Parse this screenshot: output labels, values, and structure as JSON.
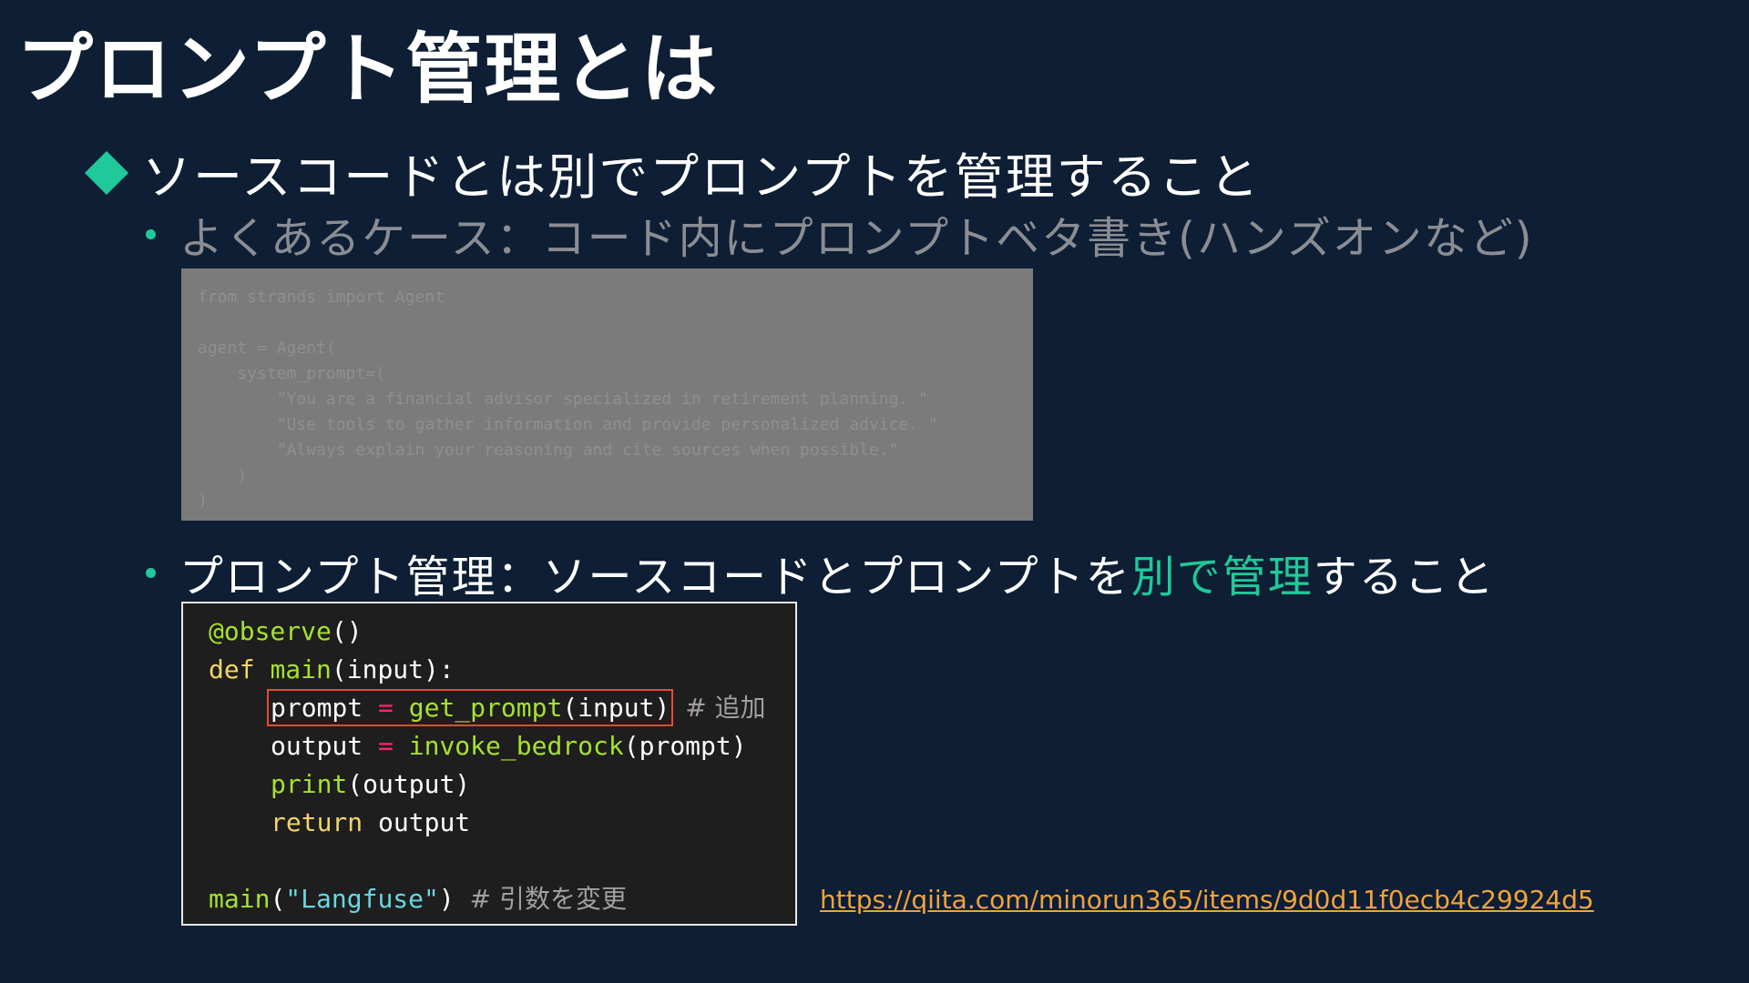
{
  "title": "プロンプト管理とは",
  "bullet1": "ソースコードとは別でプロンプトを管理すること",
  "bullet2a": "よくあるケース：コード内にプロンプトベタ書き(ハンズオンなど)",
  "bullet2b": {
    "prefix": "プロンプト管理：ソースコードとプロンプトを",
    "accent": "別で管理",
    "suffix": "すること"
  },
  "code_inline_prompt": [
    "from strands import Agent",
    "",
    "agent = Agent(",
    "    system_prompt=(",
    "        \"You are a financial advisor specialized in retirement planning. \"",
    "        \"Use tools to gather information and provide personalized advice. \"",
    "        \"Always explain your reasoning and cite sources when possible.\"",
    "    )",
    ")"
  ],
  "code_managed": {
    "l1_decorator": "@observe",
    "l1_parens": "()",
    "l2_kw": "def",
    "l2_fn": "main",
    "l2_rest": "(input):",
    "l3_var": "prompt",
    "l3_op": "=",
    "l3_fn": "get_prompt",
    "l3_args": "(input)",
    "l3_comment": "# 追加",
    "l4_var": "output",
    "l4_op": "=",
    "l4_fn": "invoke_bedrock",
    "l4_args": "(prompt)",
    "l5_fn": "print",
    "l5_args": "(output)",
    "l6_kw": "return",
    "l6_rest": "output",
    "l8_fn": "main",
    "l8_open": "(",
    "l8_str": "\"Langfuse\"",
    "l8_close": ")",
    "l8_comment": "# 引数を変更"
  },
  "link": "https://qiita.com/minorun365/items/9d0d11f0ecb4c29924d5",
  "colors": {
    "background": "#0e1e34",
    "accent": "#1fc99a",
    "link": "#f0a33a",
    "highlight_box": "#e84a2f"
  }
}
